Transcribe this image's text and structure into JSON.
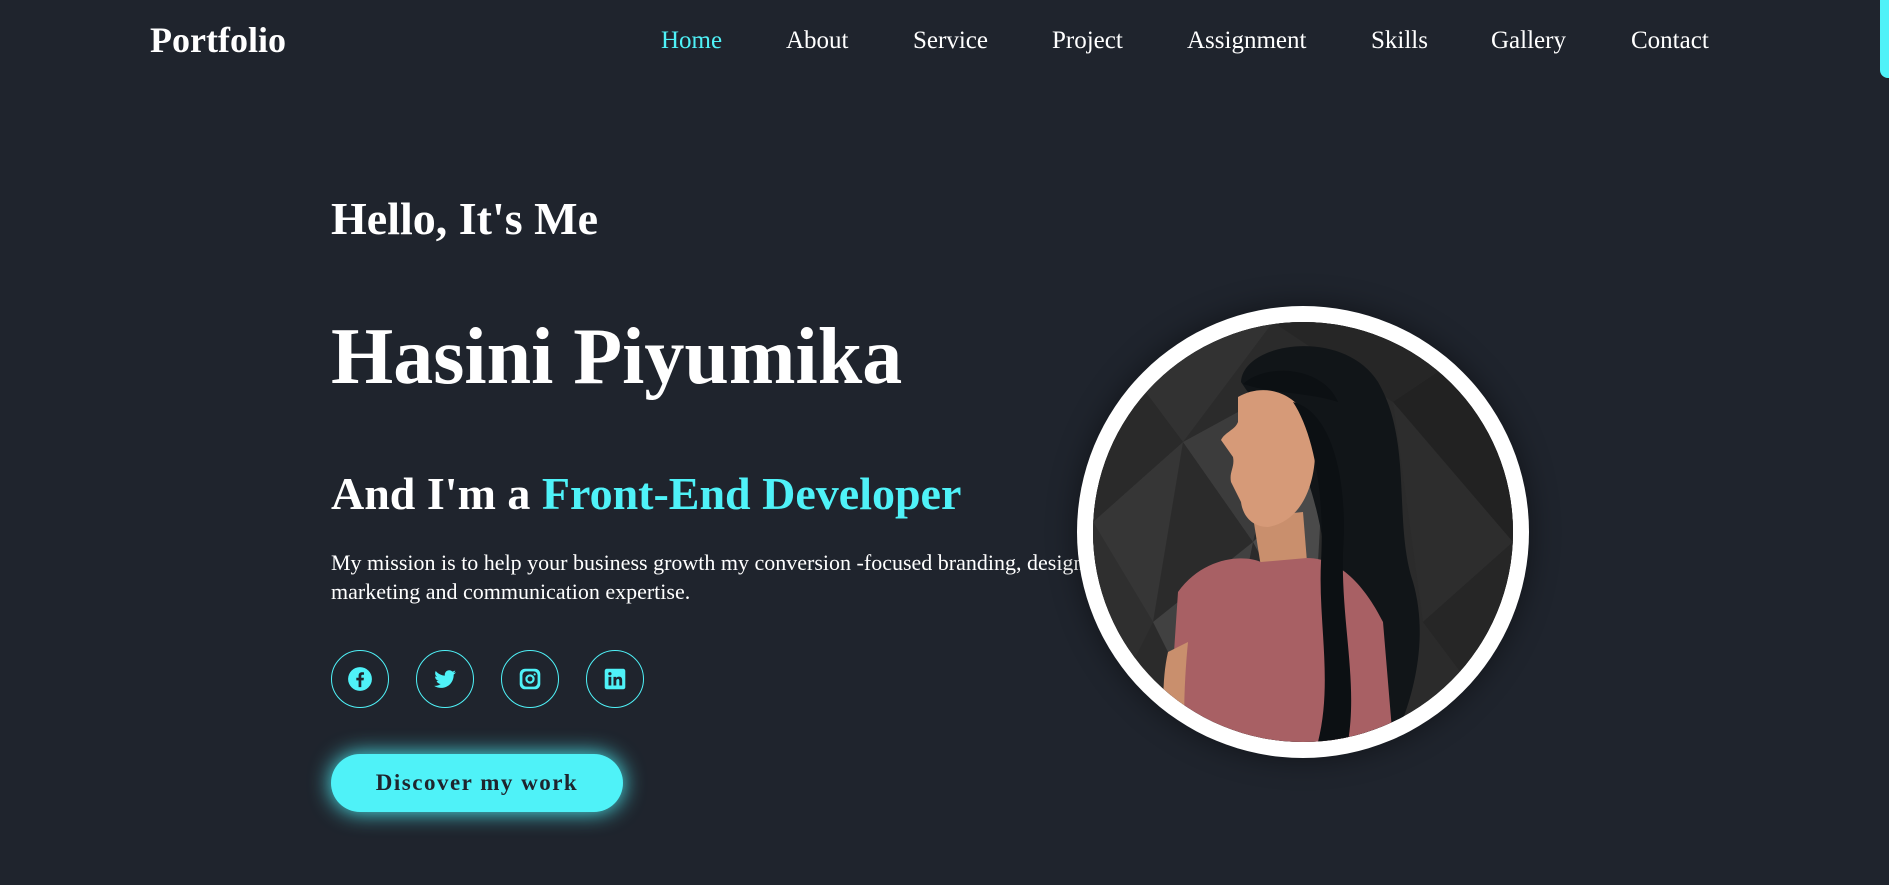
{
  "header": {
    "logo": "Portfolio",
    "nav": [
      {
        "label": "Home",
        "active": true
      },
      {
        "label": "About",
        "active": false
      },
      {
        "label": "Service",
        "active": false
      },
      {
        "label": "Project",
        "active": false
      },
      {
        "label": "Assignment",
        "active": false
      },
      {
        "label": "Skills",
        "active": false
      },
      {
        "label": "Gallery",
        "active": false
      },
      {
        "label": "Contact",
        "active": false
      }
    ]
  },
  "hero": {
    "greeting": "Hello, It's Me",
    "name": "Hasini Piyumika",
    "role_prefix": "And I'm a ",
    "role_accent": "Front-End Developer",
    "mission": "My mission is to help your business growth my conversion -focused branding, design, marketing and communication expertise.",
    "cta_label": "Discover my work",
    "socials": [
      {
        "icon": "facebook-icon"
      },
      {
        "icon": "twitter-icon"
      },
      {
        "icon": "instagram-icon"
      },
      {
        "icon": "linkedin-icon"
      }
    ],
    "profile_image": "profile-photo"
  },
  "colors": {
    "background": "#1f242d",
    "accent": "#4ff2f8",
    "text": "#ffffff"
  }
}
